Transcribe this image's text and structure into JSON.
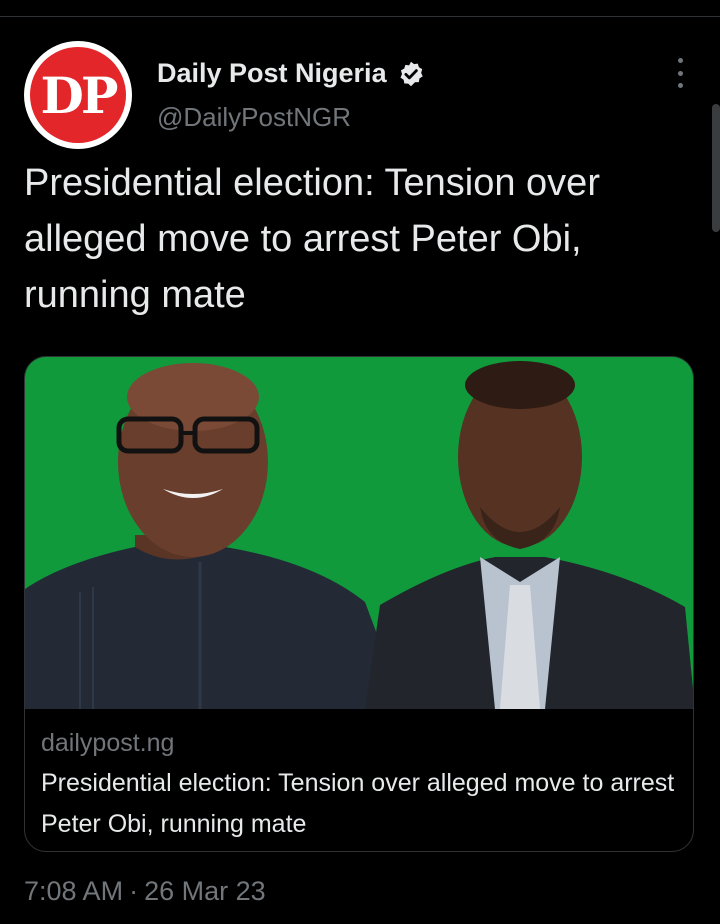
{
  "author": {
    "avatar_text": "DP",
    "display_name": "Daily Post Nigeria",
    "handle": "@DailyPostNGR",
    "verified": true
  },
  "tweet": {
    "text": "Presidential election: Tension over alleged move to arrest Peter Obi, running mate",
    "time": "7:08 AM",
    "date": "26 Mar 23",
    "separator": "·"
  },
  "card": {
    "domain": "dailypost.ng",
    "title": "Presidential election: Tension over alleged move to arrest Peter Obi, running mate"
  },
  "colors": {
    "background": "#000000",
    "text": "#e7e9ea",
    "secondary": "#71767b",
    "card_bg_green": "#109a3c",
    "avatar_red": "#e3262a"
  },
  "icons": [
    "verified-badge-icon",
    "more-options-icon"
  ]
}
